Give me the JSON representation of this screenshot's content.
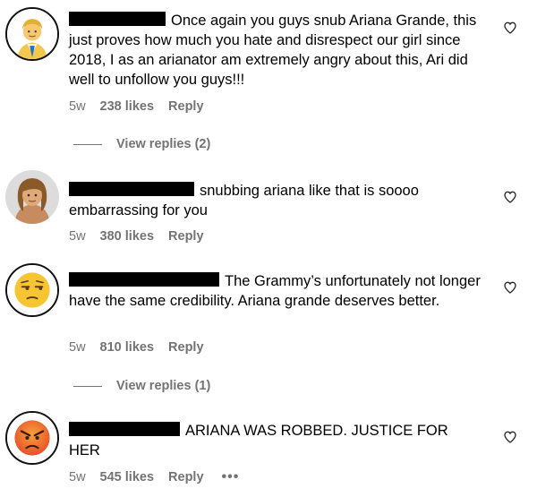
{
  "comments": [
    {
      "avatar_icon": "person-emoji-icon",
      "text": "Once again you guys snub Ariana Grande, this just proves how much you hate and disrespect our girl since 2018, I as an arianator am extremely angry about this, Ari did well to unfollow you guys!!!",
      "time": "5w",
      "likes": "238 likes",
      "reply": "Reply",
      "view_replies": "View replies (2)"
    },
    {
      "avatar_icon": "woman-emoji-icon",
      "text": "snubbing ariana like that is soooo embarrassing for you",
      "time": "5w",
      "likes": "380 likes",
      "reply": "Reply"
    },
    {
      "avatar_icon": "unamused-face-icon",
      "text": "The Grammy’s unfortunately not longer have the same credibility. Ariana grande deserves better.",
      "time": "5w",
      "likes": "810 likes",
      "reply": "Reply",
      "view_replies": "View replies (1)"
    },
    {
      "avatar_icon": "angry-face-icon",
      "text": "ARIANA WAS ROBBED. JUSTICE FOR HER",
      "time": "5w",
      "likes": "545 likes",
      "reply": "Reply",
      "more": "•••"
    }
  ],
  "icons": {
    "like": "heart-outline-icon"
  }
}
